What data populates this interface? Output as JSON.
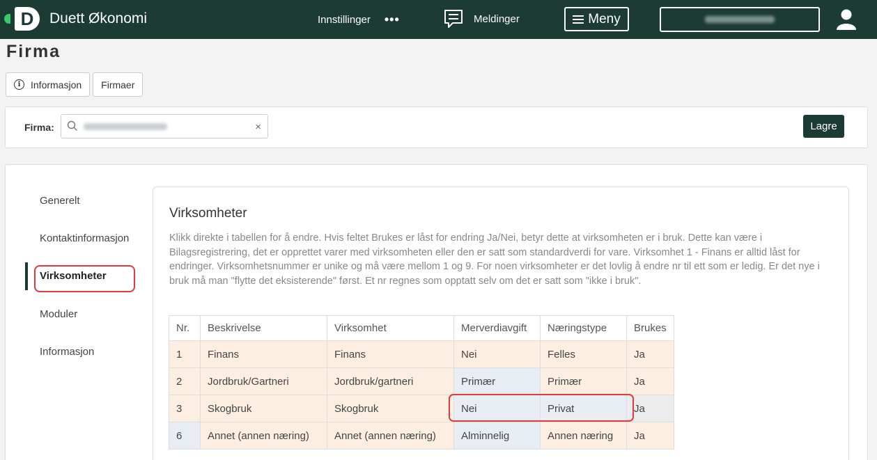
{
  "app": {
    "name": "Duett Økonomi",
    "logo_letter": "D"
  },
  "topbar": {
    "settings_label": "Innstillinger",
    "more_label": "•••",
    "messages_label": "Meldinger",
    "menu_label": "Meny"
  },
  "page": {
    "title": "Firma"
  },
  "subnav": {
    "info_label": "Informasjon",
    "companies_label": "Firmaer"
  },
  "firma": {
    "label": "Firma:",
    "clear_label": "×",
    "save_label": "Lagre"
  },
  "sidenav": {
    "items": [
      {
        "label": "Generelt"
      },
      {
        "label": "Kontaktinformasjon"
      },
      {
        "label": "Virksomheter"
      },
      {
        "label": "Moduler"
      },
      {
        "label": "Informasjon"
      }
    ],
    "active": "Virksomheter"
  },
  "content": {
    "title": "Virksomheter",
    "description": "Klikk direkte i tabellen for å endre. Hvis feltet Brukes er låst for endring Ja/Nei, betyr dette at virksomheten er i bruk. Dette kan være i Bilagsregistrering, det er opprettet varer med virksomheten eller den er satt som standardverdi for vare. Virksomhet 1 - Finans er alltid låst for endringer. Virksomhetsnummer er unike og må være mellom 1 og 9. For noen virksomheter er det lovlig å endre nr til ett som er ledig. Er det nye i bruk må man \"flytte det eksisterende\" først. Et nr regnes som opptatt selv om det er satt som \"ikke i bruk\"."
  },
  "table": {
    "headers": [
      "Nr.",
      "Beskrivelse",
      "Virksomhet",
      "Merverdiavgift",
      "Næringstype",
      "Brukes"
    ],
    "rows": [
      [
        "1",
        "Finans",
        "Finans",
        "Nei",
        "Felles",
        "Ja"
      ],
      [
        "2",
        "Jordbruk/Gartneri",
        "Jordbruk/gartneri",
        "Primær",
        "Primær",
        "Ja"
      ],
      [
        "3",
        "Skogbruk",
        "Skogbruk",
        "Nei",
        "Privat",
        "Ja"
      ],
      [
        "6",
        "Annet (annen næring)",
        "Annet (annen næring)",
        "Alminnelig",
        "Annen næring",
        "Ja"
      ]
    ]
  },
  "colors": {
    "brand": "#1c3b33",
    "brand_accent": "#37c96b",
    "highlight": "#e03a3a",
    "row_beige": "#fcefe2",
    "row_blue": "#e7edf2"
  }
}
